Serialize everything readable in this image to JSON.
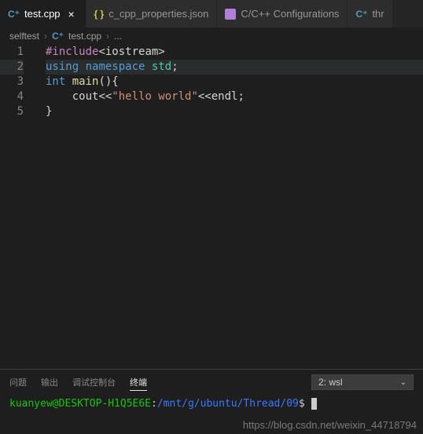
{
  "tabs": [
    {
      "label": "test.cpp",
      "icon": "cpp",
      "active": true,
      "closable": true
    },
    {
      "label": "c_cpp_properties.json",
      "icon": "json",
      "active": false,
      "closable": false
    },
    {
      "label": "C/C++ Configurations",
      "icon": "conf",
      "active": false,
      "closable": false
    },
    {
      "label": "thr",
      "icon": "cpp",
      "active": false,
      "closable": false
    }
  ],
  "breadcrumb": {
    "folder": "selftest",
    "file": "test.cpp",
    "file_icon": "cpp",
    "more": "..."
  },
  "code": {
    "lines": [
      {
        "n": "1",
        "tokens": [
          {
            "c": "c-pre",
            "t": "#include"
          },
          {
            "c": "c-punc",
            "t": "<iostream>"
          }
        ]
      },
      {
        "n": "2",
        "hl": true,
        "tokens": [
          {
            "c": "c-key",
            "t": "using"
          },
          {
            "c": "",
            "t": " "
          },
          {
            "c": "c-key",
            "t": "namespace"
          },
          {
            "c": "",
            "t": " "
          },
          {
            "c": "c-ns",
            "t": "std"
          },
          {
            "c": "c-punc",
            "t": ";"
          }
        ]
      },
      {
        "n": "3",
        "tokens": [
          {
            "c": "c-type",
            "t": "int"
          },
          {
            "c": "",
            "t": " "
          },
          {
            "c": "c-fn",
            "t": "main"
          },
          {
            "c": "c-punc",
            "t": "(){"
          }
        ]
      },
      {
        "n": "4",
        "tokens": [
          {
            "c": "",
            "t": "    "
          },
          {
            "c": "c-id",
            "t": "cout"
          },
          {
            "c": "c-op",
            "t": "<<"
          },
          {
            "c": "c-str",
            "t": "\"hello world\""
          },
          {
            "c": "c-op",
            "t": "<<"
          },
          {
            "c": "c-id",
            "t": "endl"
          },
          {
            "c": "c-punc",
            "t": ";"
          }
        ]
      },
      {
        "n": "5",
        "tokens": [
          {
            "c": "c-punc",
            "t": "}"
          }
        ]
      }
    ]
  },
  "panel": {
    "tabs": {
      "problems": "问题",
      "output": "输出",
      "debug": "调试控制台",
      "terminal": "终端"
    },
    "active": "terminal",
    "terminal_select": "2: wsl"
  },
  "terminal": {
    "user_host": "kuanyew@DESKTOP-H1Q5E6E",
    "colon": ":",
    "path": "/mnt/g/ubuntu/Thread/09",
    "dollar": "$"
  },
  "watermark": "https://blog.csdn.net/weixin_44718794"
}
